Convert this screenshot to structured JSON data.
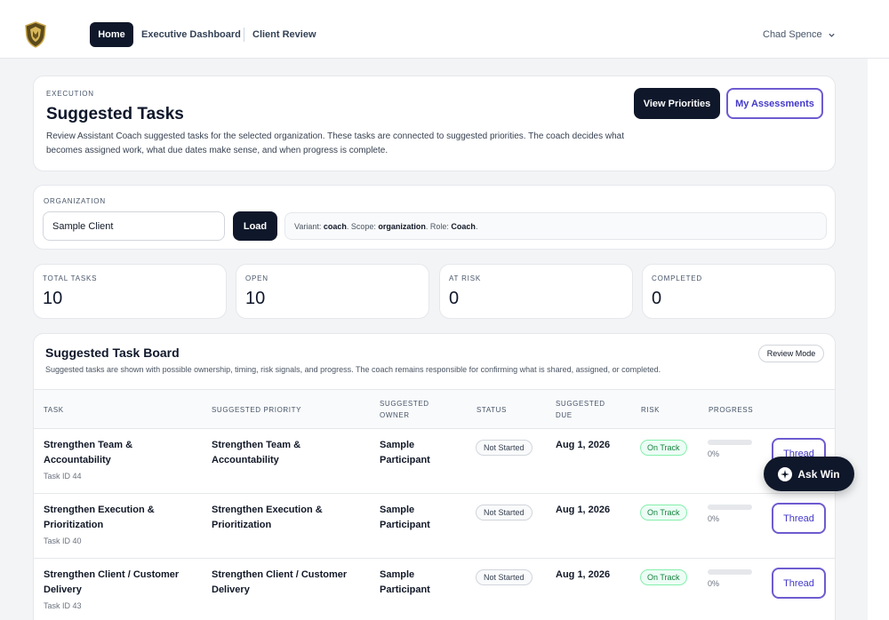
{
  "nav": {
    "home": "Home",
    "links": [
      "Executive Dashboard",
      "Client Review"
    ],
    "user": "Chad Spence"
  },
  "header": {
    "eyebrow": "EXECUTION",
    "title": "Suggested Tasks",
    "description": "Review Assistant Coach suggested tasks for the selected organization. These tasks are connected to suggested priorities. The coach decides what becomes assigned work, what due dates make sense, and when progress is complete.",
    "view_priorities": "View Priorities",
    "my_assessments": "My Assessments"
  },
  "organization": {
    "label": "ORGANIZATION",
    "value": "Sample Client",
    "load": "Load",
    "variant_label": "Variant: ",
    "variant": "coach",
    "scope_label": ". Scope: ",
    "scope": "organization",
    "role_label": ". Role: ",
    "role": "Coach",
    "end": "."
  },
  "stats": [
    {
      "label": "TOTAL TASKS",
      "value": "10"
    },
    {
      "label": "OPEN",
      "value": "10"
    },
    {
      "label": "AT RISK",
      "value": "0"
    },
    {
      "label": "COMPLETED",
      "value": "0"
    }
  ],
  "board": {
    "title": "Suggested Task Board",
    "description": "Suggested tasks are shown with possible ownership, timing, risk signals, and progress. The coach remains responsible for confirming what is shared, assigned, or completed.",
    "review_mode": "Review Mode",
    "columns": [
      "TASK",
      "SUGGESTED PRIORITY",
      "SUGGESTED\nOWNER",
      "STATUS",
      "SUGGESTED\nDUE",
      "RISK",
      "PROGRESS"
    ],
    "rows": [
      {
        "task": "Strengthen Team & Accountability",
        "task_id": "Task ID 44",
        "priority": "Strengthen Team & Accountability",
        "owner": "Sample Participant",
        "status": "Not Started",
        "due": "Aug 1, 2026",
        "risk": "On Track",
        "progress": 0,
        "progress_text": "0%",
        "action": "Thread"
      },
      {
        "task": "Strengthen Execution & Prioritization",
        "task_id": "Task ID 40",
        "priority": "Strengthen Execution & Prioritization",
        "owner": "Sample Participant",
        "status": "Not Started",
        "due": "Aug 1, 2026",
        "risk": "On Track",
        "progress": 0,
        "progress_text": "0%",
        "action": "Thread"
      },
      {
        "task": "Strengthen Client / Customer Delivery",
        "task_id": "Task ID 43",
        "priority": "Strengthen Client / Customer Delivery",
        "owner": "Sample Participant",
        "status": "Not Started",
        "due": "Aug 1, 2026",
        "risk": "On Track",
        "progress": 0,
        "progress_text": "0%",
        "action": "Thread"
      }
    ]
  },
  "ask": {
    "label": "Ask Win"
  },
  "colors": {
    "navy": "#0f172a",
    "accent": "#6d5bd0",
    "success": "#15803d",
    "background": "#f3f4f6"
  }
}
